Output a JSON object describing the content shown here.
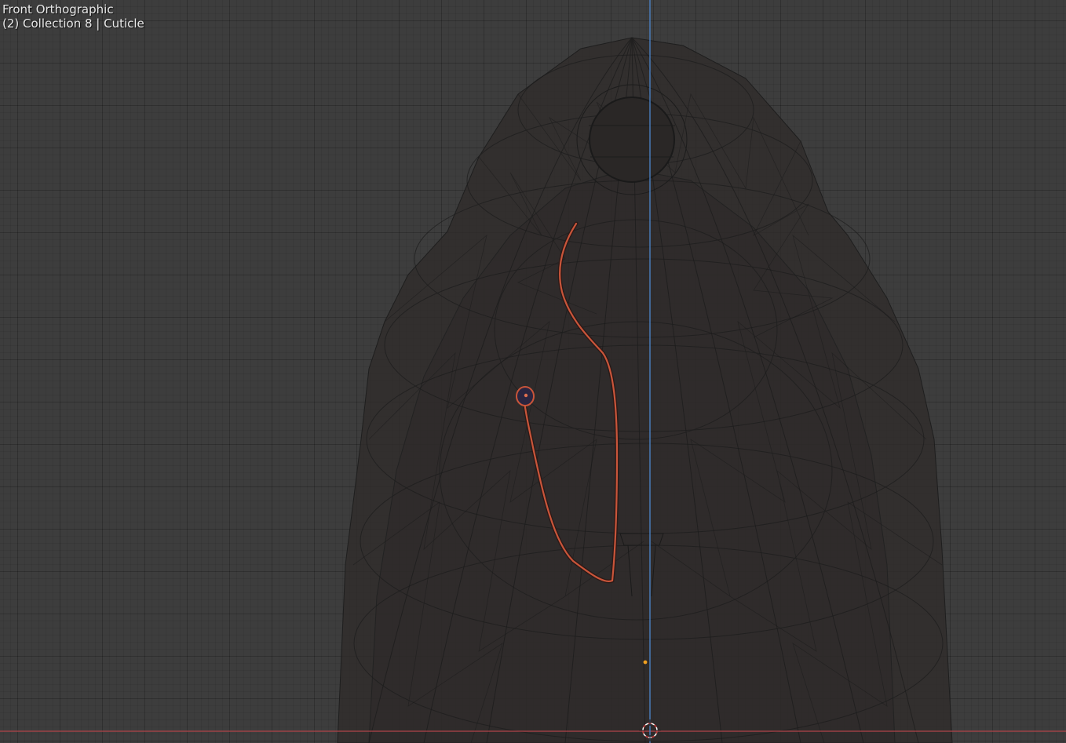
{
  "viewport": {
    "view_name": "Front Orthographic",
    "context_info": "(2) Collection 8 | Cuticle"
  },
  "colors": {
    "background": "#3d3d3d",
    "mesh_fill": "#302d2c",
    "wire": "#1c1c1c",
    "x_axis": "#b0444a",
    "z_axis": "#4a7fc0",
    "curve": "#c9553a",
    "origin_dot": "#f0a020"
  }
}
